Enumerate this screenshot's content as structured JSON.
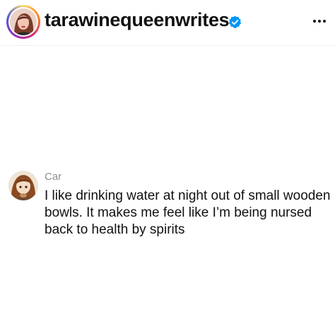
{
  "post": {
    "username": "tarawinequeenwrites",
    "verified_icon": "verified-badge-icon",
    "more_icon": "more-horizontal-icon"
  },
  "comment": {
    "author": "Car",
    "text": "I like drinking water at night out of small wooden bowls. It makes me feel like I’m being nursed back to health by spirits"
  },
  "colors": {
    "verified": "#0095f6",
    "secondary_text": "#8e8e8e",
    "primary_text": "#111111"
  }
}
